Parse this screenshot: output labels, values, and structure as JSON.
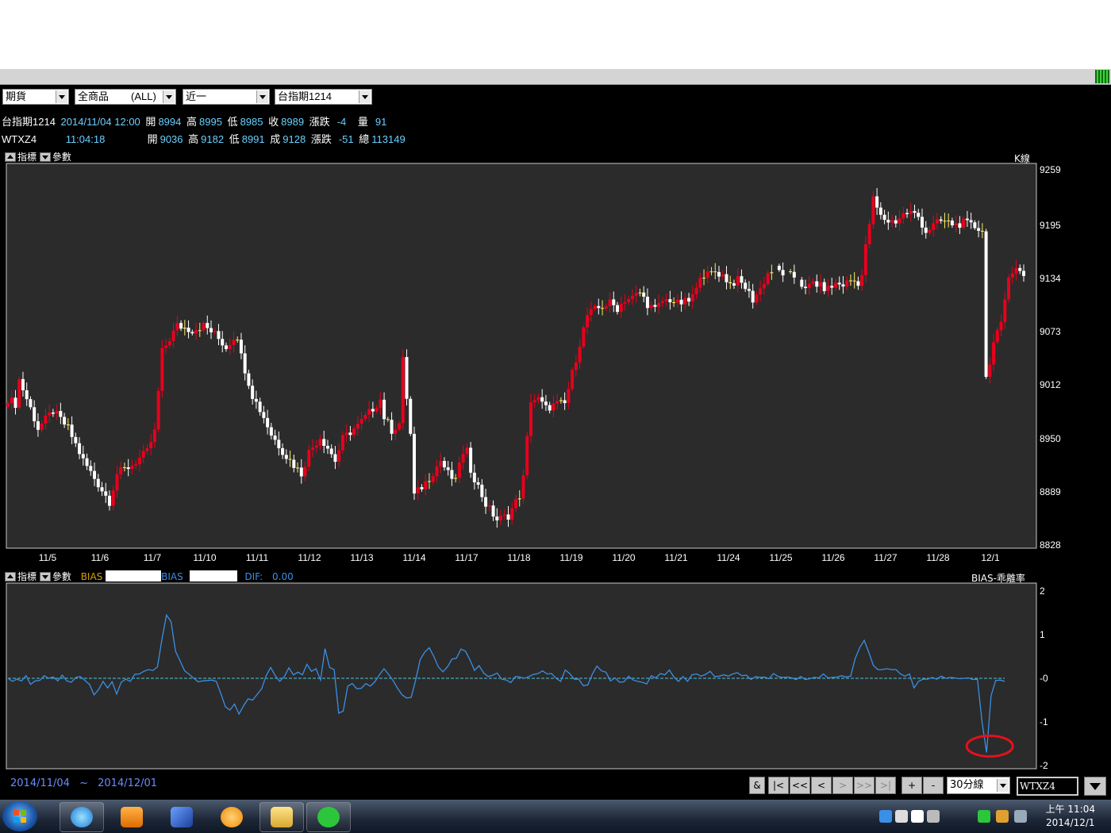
{
  "toolbar": {
    "market_select": "期貨",
    "product_select": "全商品",
    "product_all": "(ALL)",
    "period_select": "近一",
    "contract_select": "台指期1214"
  },
  "quote1": {
    "name": "台指期1214",
    "datetime": "2014/11/04 12:00",
    "open_label": "開",
    "open": "8994",
    "high_label": "高",
    "high": "8995",
    "low_label": "低",
    "low": "8985",
    "close_label": "收",
    "close": "8989",
    "change_label": "漲跌",
    "change": "-4",
    "volume_label": "量",
    "volume": "91"
  },
  "quote2": {
    "name": "WTXZ4",
    "time": "11:04:18",
    "open_label": "開",
    "open": "9036",
    "high_label": "高",
    "high": "9182",
    "low_label": "低",
    "low": "8991",
    "last_label": "成",
    "last": "9128",
    "change_label": "漲跌",
    "change": "-51",
    "total_label": "總",
    "total": "113149"
  },
  "upper_panel": {
    "tab_indicator": "指標",
    "tab_params": "參數",
    "chart_label": "K線"
  },
  "lower_panel": {
    "tab_indicator": "指標",
    "tab_params": "參數",
    "bias1_label": "BIAS",
    "bias2_label": "BIAS",
    "dif_label": "DIF:",
    "dif_value": "0.00",
    "chart_label": "BIAS-乖離率"
  },
  "chart_data": [
    {
      "type": "candlestick",
      "title": "",
      "chart_label": "K線",
      "ylim": [
        8828,
        9259
      ],
      "y_ticks": [
        9259,
        9195,
        9134,
        9073,
        9012,
        8950,
        8889,
        8828
      ],
      "x_ticks": [
        "11/5",
        "11/6",
        "11/7",
        "11/10",
        "11/11",
        "11/12",
        "11/13",
        "11/14",
        "11/17",
        "11/18",
        "11/19",
        "11/20",
        "11/21",
        "11/24",
        "11/25",
        "11/26",
        "11/27",
        "11/28",
        "12/1"
      ],
      "grid": false,
      "up_color": "#e8001c",
      "down_color": "#ffffff",
      "doji_color": "#ffee66",
      "anchors": [
        [
          0,
          8996
        ],
        [
          2,
          8990
        ],
        [
          3,
          9018
        ],
        [
          6,
          8985
        ],
        [
          8,
          8962
        ],
        [
          12,
          8982
        ],
        [
          16,
          8962
        ],
        [
          20,
          8925
        ],
        [
          24,
          8898
        ],
        [
          27,
          8878
        ],
        [
          29,
          8910
        ],
        [
          33,
          8920
        ],
        [
          37,
          8935
        ],
        [
          39,
          8958
        ],
        [
          41,
          9050
        ],
        [
          45,
          9080
        ],
        [
          49,
          9075
        ],
        [
          52,
          9080
        ],
        [
          55,
          9070
        ],
        [
          58,
          9055
        ],
        [
          60,
          9067
        ],
        [
          61,
          9068
        ],
        [
          62,
          9045
        ],
        [
          65,
          9000
        ],
        [
          68,
          8975
        ],
        [
          70,
          8955
        ],
        [
          74,
          8930
        ],
        [
          78,
          8910
        ],
        [
          80,
          8935
        ],
        [
          83,
          8952
        ],
        [
          85,
          8940
        ],
        [
          87,
          8925
        ],
        [
          89,
          8950
        ],
        [
          91,
          8958
        ],
        [
          93,
          8965
        ],
        [
          95,
          8975
        ],
        [
          97,
          8985
        ],
        [
          99,
          8995
        ],
        [
          100,
          8975
        ],
        [
          102,
          8960
        ],
        [
          104,
          8968
        ],
        [
          105,
          9040
        ],
        [
          107,
          8955
        ],
        [
          108,
          8885
        ],
        [
          110,
          8895
        ],
        [
          112,
          8905
        ],
        [
          115,
          8925
        ],
        [
          117,
          8910
        ],
        [
          119,
          8900
        ],
        [
          120,
          8925
        ],
        [
          122,
          8935
        ],
        [
          123,
          8915
        ],
        [
          125,
          8895
        ],
        [
          127,
          8875
        ],
        [
          130,
          8857
        ],
        [
          133,
          8862
        ],
        [
          136,
          8885
        ],
        [
          137,
          8905
        ],
        [
          139,
          8995
        ],
        [
          141,
          8995
        ],
        [
          143,
          8985
        ],
        [
          146,
          8990
        ],
        [
          148,
          8990
        ],
        [
          150,
          9025
        ],
        [
          152,
          9060
        ],
        [
          154,
          9092
        ],
        [
          156,
          9098
        ],
        [
          158,
          9102
        ],
        [
          160,
          9106
        ],
        [
          162,
          9100
        ],
        [
          164,
          9110
        ],
        [
          166,
          9112
        ],
        [
          168,
          9118
        ],
        [
          170,
          9105
        ],
        [
          172,
          9098
        ],
        [
          174,
          9108
        ],
        [
          176,
          9110
        ],
        [
          178,
          9105
        ],
        [
          181,
          9108
        ],
        [
          183,
          9120
        ],
        [
          184,
          9140
        ],
        [
          186,
          9138
        ],
        [
          188,
          9142
        ],
        [
          190,
          9138
        ],
        [
          192,
          9128
        ],
        [
          194,
          9132
        ],
        [
          196,
          9124
        ],
        [
          198,
          9110
        ],
        [
          200,
          9122
        ],
        [
          202,
          9140
        ],
        [
          204,
          9145
        ],
        [
          206,
          9140
        ],
        [
          208,
          9137
        ],
        [
          210,
          9135
        ],
        [
          212,
          9120
        ],
        [
          214,
          9130
        ],
        [
          216,
          9125
        ],
        [
          218,
          9122
        ],
        [
          220,
          9128
        ],
        [
          222,
          9127
        ],
        [
          224,
          9132
        ],
        [
          226,
          9130
        ],
        [
          227,
          9138
        ],
        [
          228,
          9170
        ],
        [
          230,
          9225
        ],
        [
          232,
          9205
        ],
        [
          234,
          9200
        ],
        [
          236,
          9200
        ],
        [
          238,
          9208
        ],
        [
          240,
          9210
        ],
        [
          242,
          9205
        ],
        [
          244,
          9188
        ],
        [
          246,
          9195
        ],
        [
          248,
          9200
        ],
        [
          250,
          9198
        ],
        [
          252,
          9196
        ],
        [
          254,
          9198
        ],
        [
          256,
          9195
        ],
        [
          258,
          9192
        ],
        [
          259,
          9190
        ],
        [
          260,
          9020
        ],
        [
          262,
          9060
        ],
        [
          264,
          9080
        ],
        [
          266,
          9140
        ],
        [
          268,
          9145
        ],
        [
          270,
          9138
        ]
      ]
    },
    {
      "type": "line",
      "title": "",
      "chart_label": "BIAS-乖離率",
      "ylim": [
        -2,
        2
      ],
      "y_ticks": [
        2,
        1,
        0,
        -1,
        -2
      ],
      "y_tick_labels": [
        "2",
        "1",
        "-0",
        "-1",
        "-2"
      ],
      "line_color": "#3a8fe6",
      "zero_line_color": "#4cc4d8",
      "values": [
        0.0,
        -0.07,
        -0.02,
        -0.06,
        0.06,
        -0.14,
        -0.06,
        -0.05,
        0.06,
        0.0,
        0.03,
        -0.06,
        0.07,
        -0.06,
        -0.09,
        0.02,
        0.04,
        -0.05,
        -0.14,
        -0.38,
        -0.26,
        -0.07,
        -0.22,
        -0.08,
        -0.36,
        -0.09,
        -0.02,
        -0.07,
        0.09,
        0.1,
        0.16,
        0.2,
        0.18,
        0.26,
        0.9,
        1.45,
        1.3,
        0.62,
        0.4,
        0.17,
        0.09,
        0.0,
        -0.08,
        -0.06,
        -0.05,
        -0.04,
        -0.07,
        -0.35,
        -0.65,
        -0.73,
        -0.59,
        -0.82,
        -0.63,
        -0.47,
        -0.5,
        -0.37,
        -0.24,
        0.06,
        0.25,
        0.06,
        -0.07,
        0.04,
        0.24,
        0.08,
        0.14,
        0.08,
        0.32,
        0.16,
        0.22,
        -0.04,
        0.68,
        0.25,
        0.2,
        -0.8,
        -0.75,
        -0.18,
        -0.12,
        -0.24,
        -0.23,
        -0.12,
        -0.18,
        -0.08,
        0.08,
        0.22,
        0.09,
        -0.05,
        -0.23,
        -0.38,
        -0.45,
        -0.44,
        -0.04,
        0.43,
        0.6,
        0.7,
        0.5,
        0.26,
        0.15,
        0.26,
        0.44,
        0.46,
        0.67,
        0.62,
        0.42,
        0.18,
        0.29,
        0.12,
        0.04,
        0.07,
        0.12,
        -0.02,
        -0.04,
        -0.1,
        0.04,
        0.03,
        0.0,
        0.04,
        0.09,
        0.11,
        0.17,
        0.1,
        0.11,
        0.0,
        -0.07,
        0.19,
        0.11,
        -0.02,
        -0.02,
        -0.17,
        -0.15,
        0.1,
        0.28,
        0.17,
        0.14,
        -0.06,
        0.01,
        -0.09,
        -0.08,
        0.05,
        -0.04,
        -0.07,
        -0.09,
        -0.13,
        0.06,
        0.01,
        0.11,
        0.08,
        0.19,
        0.03,
        -0.07,
        0.04,
        -0.07,
        0.08,
        0.1,
        0.05,
        0.09,
        0.16,
        0.04,
        0.05,
        0.08,
        0.05,
        0.1,
        0.13,
        0.06,
        0.07,
        -0.03,
        0.04,
        0.02,
        0.03,
        -0.01,
        0.11,
        0.04,
        0.02,
        0.03,
        0.01,
        -0.03,
        0.04,
        -0.03,
        -0.01,
        0.02,
        0.01,
        0.1,
        0.01,
        0.02,
        0.03,
        0.06,
        0.03,
        0.05,
        0.45,
        0.7,
        0.87,
        0.6,
        0.3,
        0.2,
        0.2,
        0.22,
        0.2,
        0.2,
        0.1,
        0.05,
        0.1,
        -0.22,
        -0.07,
        -0.02,
        -0.02,
        0.02,
        -0.02,
        0.05,
        0.0,
        0.02,
        0.01,
        -0.01,
        0.0,
        0.01,
        -0.03,
        -0.02,
        -1.0,
        -1.7,
        -0.4,
        -0.05,
        -0.04,
        -0.07
      ],
      "annotation": "red-ellipse-around-minimum"
    }
  ],
  "bottom_bar": {
    "date_from": "2014/11/04",
    "date_sep": "~",
    "date_to": "2014/12/01",
    "btn_amp": "&",
    "btn_first": "|<",
    "btn_fastback": "<<",
    "btn_back": "<",
    "btn_fwd": ">",
    "btn_fastfwd": ">>",
    "btn_last": ">|",
    "btn_plus": "+",
    "btn_minus": "-",
    "interval_select": "30分線",
    "symbol_input": "WTXZ4"
  },
  "taskbar": {
    "clock_time": "上午 11:04",
    "clock_date": "2014/12/1",
    "apps": [
      "internet-explorer-icon",
      "media-player-icon",
      "app-icon",
      "orange-app-icon",
      "file-explorer-icon",
      "line-icon"
    ]
  }
}
